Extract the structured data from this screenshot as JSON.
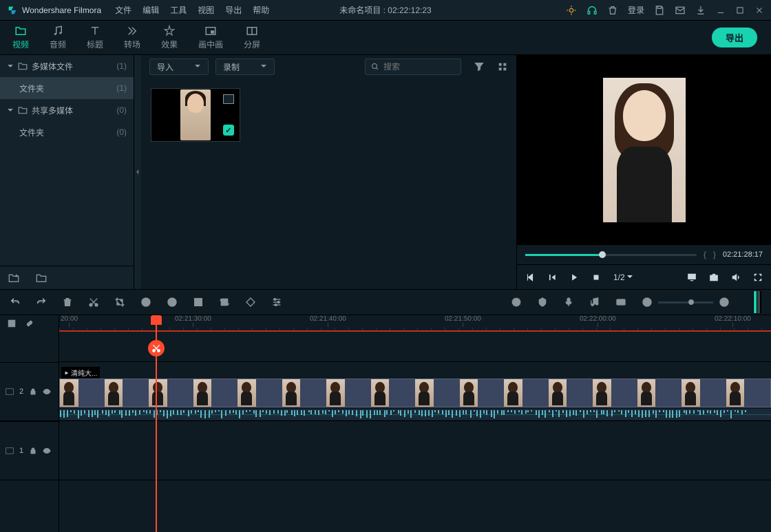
{
  "app_name": "Wondershare Filmora",
  "menu": [
    "文件",
    "编辑",
    "工具",
    "视图",
    "导出",
    "帮助"
  ],
  "project_title": "未命名项目 : 02:22:12:23",
  "login_label": "登录",
  "tabs": [
    {
      "id": "video",
      "label": "视频"
    },
    {
      "id": "audio",
      "label": "音频"
    },
    {
      "id": "title",
      "label": "标题"
    },
    {
      "id": "transition",
      "label": "转场"
    },
    {
      "id": "effect",
      "label": "效果"
    },
    {
      "id": "pip",
      "label": "画中画"
    },
    {
      "id": "split",
      "label": "分屏"
    }
  ],
  "export_label": "导出",
  "tree": [
    {
      "label": "多媒体文件",
      "count": "(1)",
      "icon": "folder",
      "collapsible": true,
      "sel": false
    },
    {
      "label": "文件夹",
      "count": "(1)",
      "icon": "",
      "collapsible": false,
      "sel": true,
      "indent": true
    },
    {
      "label": "共享多媒体",
      "count": "(0)",
      "icon": "folder",
      "collapsible": true,
      "sel": false
    },
    {
      "label": "文件夹",
      "count": "(0)",
      "icon": "",
      "collapsible": false,
      "sel": false,
      "indent": true
    }
  ],
  "import_dd": "导入",
  "record_dd": "录制",
  "search_placeholder": "搜索",
  "preview_time": "02:21:28:17",
  "playback_rate": "1/2",
  "ruler_ticks": [
    {
      "pos": 2,
      "label": "20:00"
    },
    {
      "pos": 168,
      "label": "02:21:30:00"
    },
    {
      "pos": 364,
      "label": "02:21:40:00"
    },
    {
      "pos": 560,
      "label": "02:21:50:00"
    },
    {
      "pos": 756,
      "label": "02:22:00:00"
    },
    {
      "pos": 952,
      "label": "02:22:10:00"
    }
  ],
  "track2_label": "2",
  "track1_label": "1",
  "clip_label": "清纯大..."
}
